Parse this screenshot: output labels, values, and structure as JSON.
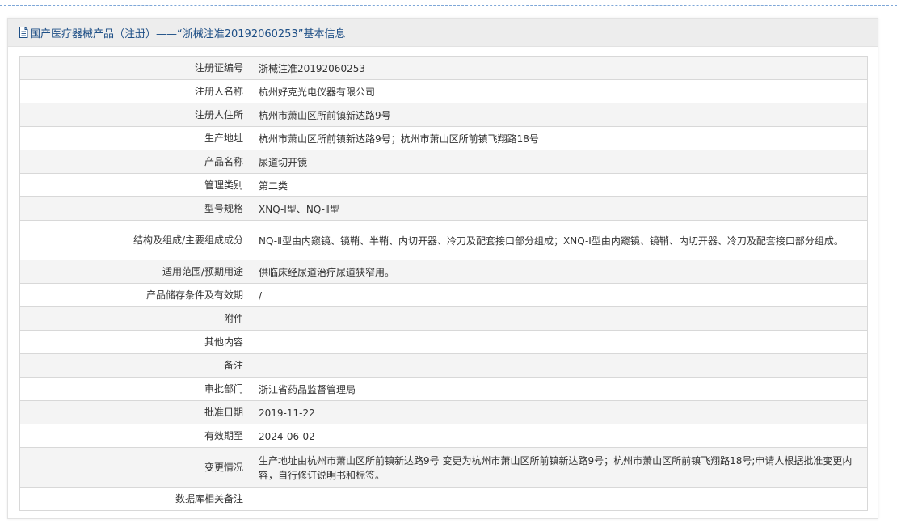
{
  "colors": {
    "title": "#1e4f86",
    "header_bg": "#ededed",
    "row_alt_bg": "#f4f4f4",
    "border": "#d8d8d8"
  },
  "header": {
    "icon": "document-icon",
    "title": "国产医疗器械产品（注册）——“浙械注准20192060253”基本信息"
  },
  "rows": [
    {
      "label": "注册证编号",
      "value": "浙械注准20192060253"
    },
    {
      "label": "注册人名称",
      "value": "杭州好克光电仪器有限公司"
    },
    {
      "label": "注册人住所",
      "value": "杭州市萧山区所前镇新达路9号"
    },
    {
      "label": "生产地址",
      "value": "杭州市萧山区所前镇新达路9号；杭州市萧山区所前镇飞翔路18号"
    },
    {
      "label": "产品名称",
      "value": "尿道切开镜"
    },
    {
      "label": "管理类别",
      "value": "第二类"
    },
    {
      "label": "型号规格",
      "value": "XNQ-Ⅰ型、NQ-Ⅱ型"
    },
    {
      "label": "结构及组成/主要组成成分",
      "value": "NQ-Ⅱ型由内窥镜、镜鞘、半鞘、内切开器、冷刀及配套接口部分组成；XNQ-Ⅰ型由内窥镜、镜鞘、内切开器、冷刀及配套接口部分组成。"
    },
    {
      "label": "适用范围/预期用途",
      "value": "供临床经尿道治疗尿道狭窄用。"
    },
    {
      "label": "产品储存条件及有效期",
      "value": "/"
    },
    {
      "label": "附件",
      "value": ""
    },
    {
      "label": "其他内容",
      "value": ""
    },
    {
      "label": "备注",
      "value": ""
    },
    {
      "label": "审批部门",
      "value": "浙江省药品监督管理局"
    },
    {
      "label": "批准日期",
      "value": "2019-11-22"
    },
    {
      "label": "有效期至",
      "value": "2024-06-02"
    },
    {
      "label": "变更情况",
      "value": "生产地址由杭州市萧山区所前镇新达路9号 变更为杭州市萧山区所前镇新达路9号；杭州市萧山区所前镇飞翔路18号;申请人根据批准变更内容，自行修订说明书和标签。"
    },
    {
      "label": "数据库相关备注",
      "value": ""
    }
  ]
}
